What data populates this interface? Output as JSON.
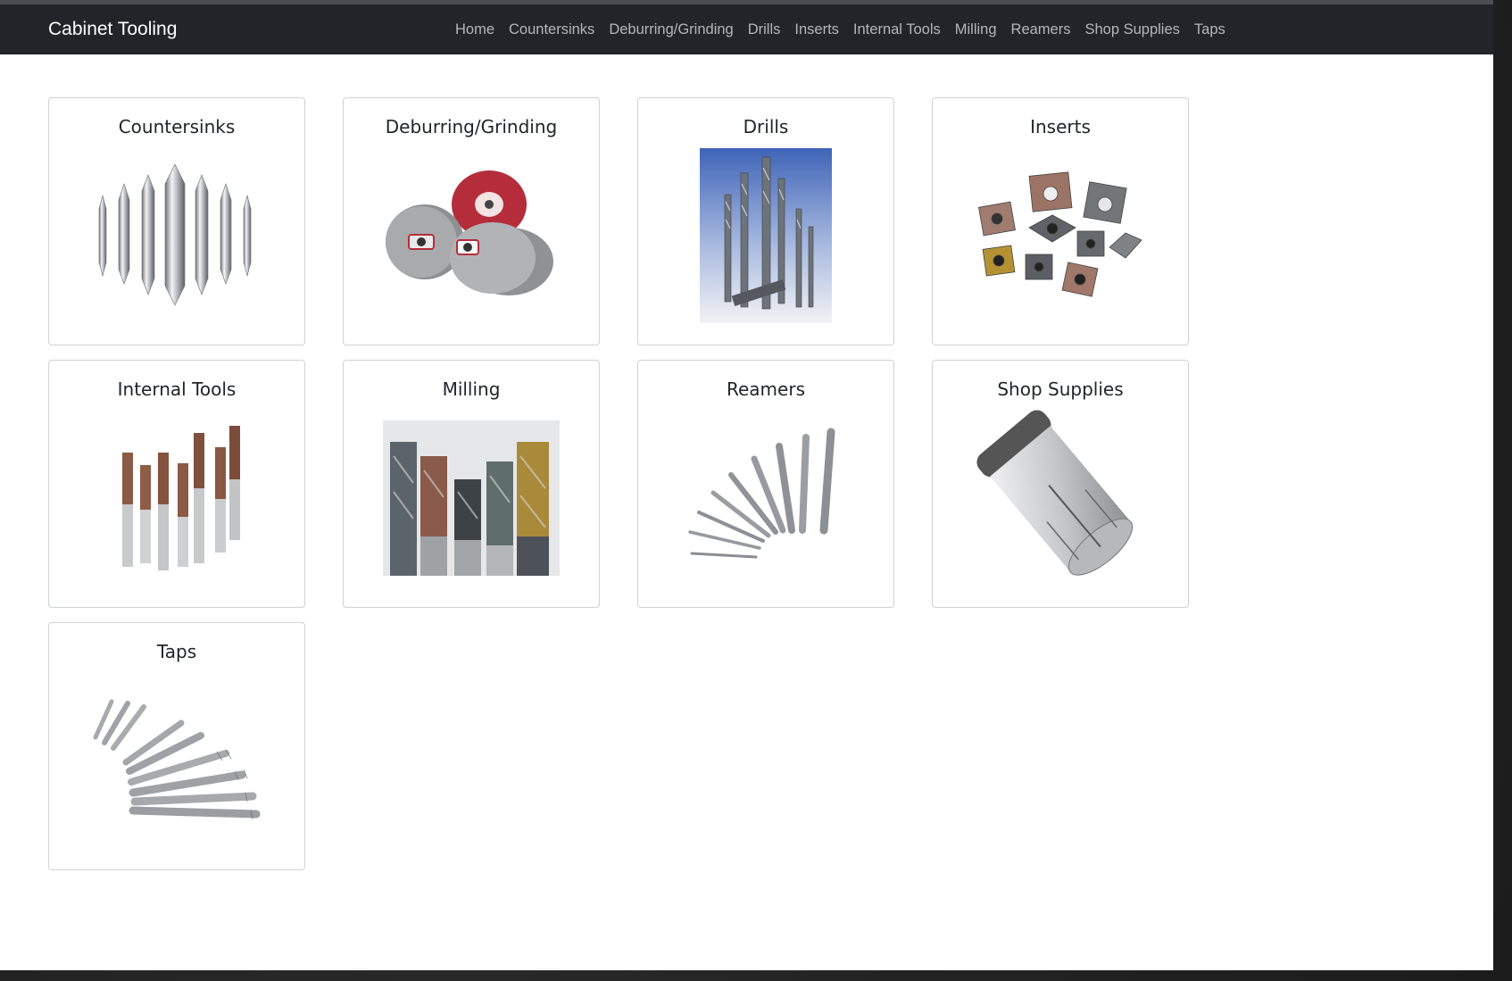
{
  "navbar": {
    "brand": "Cabinet Tooling",
    "links": [
      "Home",
      "Countersinks",
      "Deburring/Grinding",
      "Drills",
      "Inserts",
      "Internal Tools",
      "Milling",
      "Reamers",
      "Shop Supplies",
      "Taps"
    ]
  },
  "categories": [
    {
      "title": "Countersinks",
      "image": "countersinks-image"
    },
    {
      "title": "Deburring/Grinding",
      "image": "grinding-wheels-image"
    },
    {
      "title": "Drills",
      "image": "drills-image"
    },
    {
      "title": "Inserts",
      "image": "inserts-image"
    },
    {
      "title": "Internal Tools",
      "image": "internal-tools-image"
    },
    {
      "title": "Milling",
      "image": "end-mills-image"
    },
    {
      "title": "Reamers",
      "image": "reamers-image"
    },
    {
      "title": "Shop Supplies",
      "image": "collet-image"
    },
    {
      "title": "Taps",
      "image": "taps-image"
    }
  ]
}
